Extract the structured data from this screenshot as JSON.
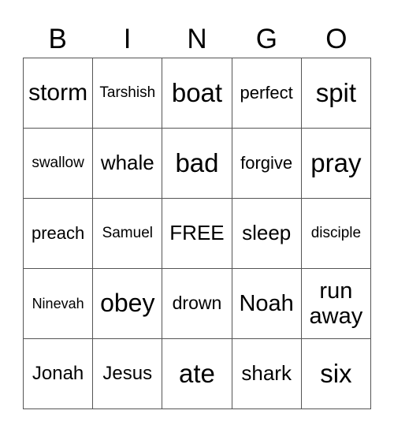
{
  "header": [
    "B",
    "I",
    "N",
    "G",
    "O"
  ],
  "rows": [
    [
      "storm",
      "Tarshish",
      "boat",
      "perfect",
      "spit"
    ],
    [
      "swallow",
      "whale",
      "bad",
      "forgive",
      "pray"
    ],
    [
      "preach",
      "Samuel",
      "FREE",
      "sleep",
      "disciple"
    ],
    [
      "Ninevah",
      "obey",
      "drown",
      "Noah",
      "run away"
    ],
    [
      "Jonah",
      "Jesus",
      "ate",
      "shark",
      "six"
    ]
  ]
}
